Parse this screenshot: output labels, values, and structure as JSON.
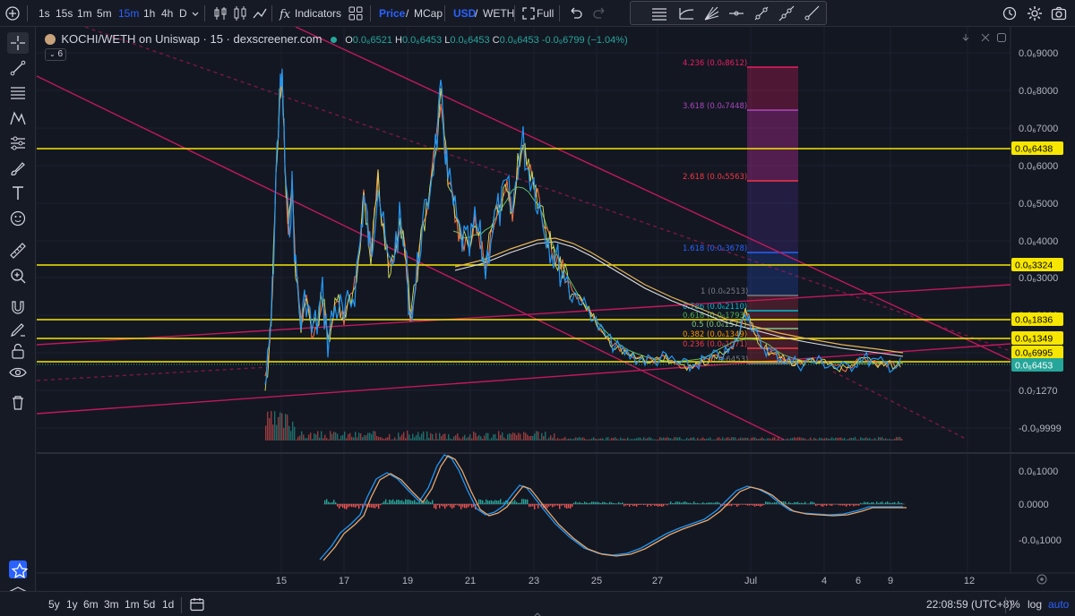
{
  "toolbar": {
    "intervals": [
      "1s",
      "15s",
      "1m",
      "5m",
      "15m",
      "1h",
      "4h",
      "D"
    ],
    "active_interval": "15m",
    "indicators_label": "Indicators",
    "price_label": "Price",
    "mcap_label": "MCap",
    "usd_label": "USD",
    "weth_label": "WETH",
    "full_label": "Full",
    "slash": "/"
  },
  "legend": {
    "title": "KOCHI/WETH on Uniswap · 15 · dexscreener.com",
    "open_label": "O",
    "open": "0.0₆6521",
    "high_label": "H",
    "high": "0.0₆6453",
    "low_label": "L",
    "low": "0.0₆6453",
    "close_label": "C",
    "close": "0.0₆6453",
    "change": "-0.0₉6799 (−1.04%)",
    "indicator_count": "6"
  },
  "price_axis": {
    "ticks": [
      "0.0₆9000",
      "0.0₆8000",
      "0.0₆7000",
      "0.0₆6000",
      "0.0₆5000",
      "0.0₆4000",
      "0.0₆3000",
      "0.0₆2000",
      "0.0₇1270",
      "-0.0₉9999"
    ],
    "tags": [
      {
        "label": "0.0₆6438",
        "bg": "#f7e600",
        "fg": "#000000"
      },
      {
        "label": "0.0₆3324",
        "bg": "#f7e600",
        "fg": "#000000"
      },
      {
        "label": "0.0₆1836",
        "bg": "#f7e600",
        "fg": "#000000"
      },
      {
        "label": "0.0₆1349",
        "bg": "#f7e600",
        "fg": "#000000"
      },
      {
        "label": "0.0₆6995",
        "bg": "#f7e600",
        "fg": "#000000"
      },
      {
        "label": "0.0₆6453",
        "bg": "#26a69a",
        "fg": "#ffffff"
      }
    ]
  },
  "macd_axis": {
    "ticks": [
      "0.0₆1000",
      "0.0000",
      "-0.0₆1000"
    ]
  },
  "time_axis": {
    "ticks": [
      "15",
      "17",
      "19",
      "21",
      "23",
      "25",
      "27",
      "Jul",
      "4",
      "6",
      "9",
      "12"
    ]
  },
  "fib": {
    "levels": [
      {
        "label": "4.236 (0.0₆8612)",
        "color": "#e91e63"
      },
      {
        "label": "3.618 (0.0₆7448)",
        "color": "#ab47bc"
      },
      {
        "label": "2.618 (0.0₆5563)",
        "color": "#f23645"
      },
      {
        "label": "1.618 (0.0₆3678)",
        "color": "#2962ff"
      },
      {
        "label": "1 (0.0₆2513)",
        "color": "#787b86"
      },
      {
        "label": "0.786 (0.0₆2110)",
        "color": "#00bcd4"
      },
      {
        "label": "0.618 (0.0₆1793)",
        "color": "#4caf50"
      },
      {
        "label": "0.5 (0.0₆1571)",
        "color": "#81c784"
      },
      {
        "label": "0.382 (0.0₆1349)",
        "color": "#ff9800"
      },
      {
        "label": "0.236 (0.0₆1071)",
        "color": "#f23645"
      },
      {
        "label": "0 (0.0₇6453)",
        "color": "#787b86"
      }
    ]
  },
  "bottombar": {
    "ranges": [
      "5y",
      "1y",
      "6m",
      "3m",
      "1m",
      "5d",
      "1d"
    ],
    "clock": "22:08:59 (UTC+8)",
    "percent_label": "%",
    "log_label": "log",
    "auto_label": "auto"
  },
  "colors": {
    "background": "#131722",
    "support_lines": "#f7e600",
    "trend_lines": "#c2185b",
    "price_line": "#2196f3",
    "accent": "#2962ff"
  }
}
